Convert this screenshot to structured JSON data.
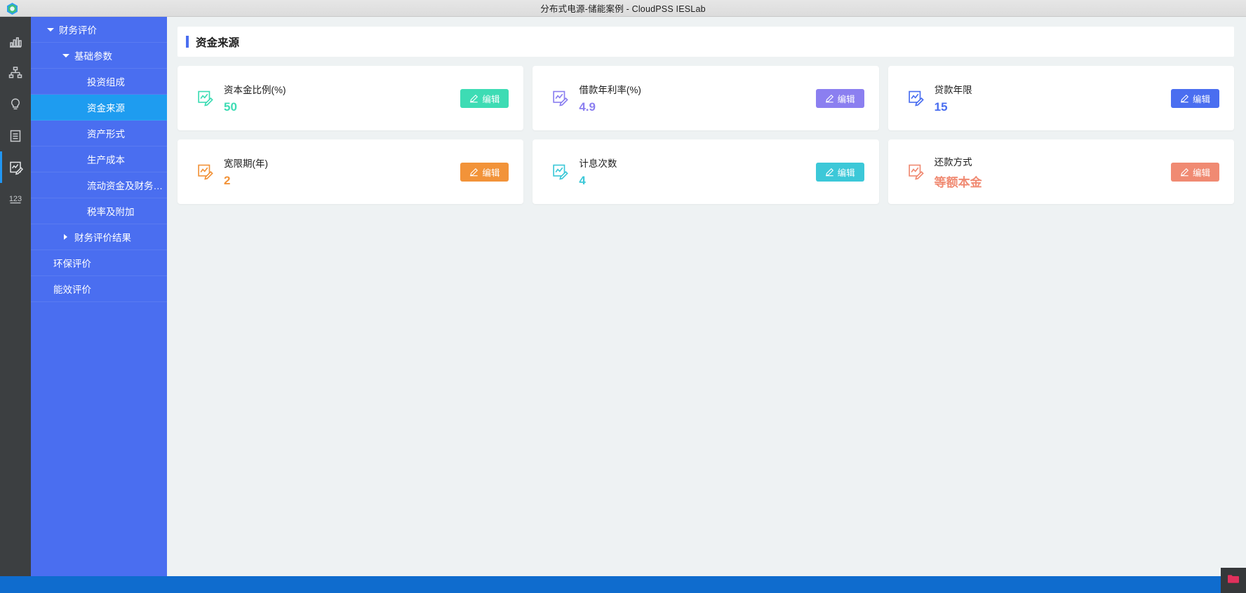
{
  "window": {
    "title": "分布式电源-储能案例 - CloudPSS IESLab",
    "logo_icon": "cloudpss-logo-icon"
  },
  "icon_rail": {
    "items": [
      {
        "icon": "bar-chart-icon",
        "active": false
      },
      {
        "icon": "org-tree-icon",
        "active": false
      },
      {
        "icon": "lightbulb-icon",
        "active": false
      },
      {
        "icon": "document-lines-icon",
        "active": false
      },
      {
        "icon": "edit-chart-icon",
        "active": true
      },
      {
        "icon": "numbers-123-icon",
        "active": false
      }
    ]
  },
  "sidebar": {
    "items": [
      {
        "label": "财务评价",
        "level": 1,
        "caret": "down",
        "selected": false
      },
      {
        "label": "基础参数",
        "level": 2,
        "caret": "down",
        "selected": false
      },
      {
        "label": "投资组成",
        "level": 3,
        "caret": "none",
        "selected": false
      },
      {
        "label": "资金来源",
        "level": 3,
        "caret": "none",
        "selected": true
      },
      {
        "label": "资产形式",
        "level": 3,
        "caret": "none",
        "selected": false
      },
      {
        "label": "生产成本",
        "level": 3,
        "caret": "none",
        "selected": false
      },
      {
        "label": "流动资金及财务…",
        "level": 3,
        "caret": "none",
        "selected": false
      },
      {
        "label": "税率及附加",
        "level": 3,
        "caret": "none",
        "selected": false
      },
      {
        "label": "财务评价结果",
        "level": 2,
        "caret": "right",
        "selected": false
      },
      {
        "label": "环保评价",
        "level": 0,
        "caret": "none",
        "selected": false
      },
      {
        "label": "能效评价",
        "level": 0,
        "caret": "none",
        "selected": false
      }
    ]
  },
  "panel": {
    "title": "资金来源",
    "accent_color": "#4a6ef0"
  },
  "cards": [
    {
      "label": "资本金比例(%)",
      "value": "50",
      "color": "#3ddcb4",
      "icon": "edit-chart-icon",
      "button_label": "编辑",
      "button_icon": "pencil-icon"
    },
    {
      "label": "借款年利率(%)",
      "value": "4.9",
      "color": "#8b7ff0",
      "icon": "edit-chart-icon",
      "button_label": "编辑",
      "button_icon": "pencil-icon"
    },
    {
      "label": "贷款年限",
      "value": "15",
      "color": "#4a6ef0",
      "icon": "edit-chart-icon",
      "button_label": "编辑",
      "button_icon": "pencil-icon"
    },
    {
      "label": "宽限期(年)",
      "value": "2",
      "color": "#f29339",
      "icon": "edit-chart-icon",
      "button_label": "编辑",
      "button_icon": "pencil-icon"
    },
    {
      "label": "计息次数",
      "value": "4",
      "color": "#3cc8d8",
      "icon": "edit-chart-icon",
      "button_label": "编辑",
      "button_icon": "pencil-icon"
    },
    {
      "label": "还款方式",
      "value": "等额本金",
      "color": "#f08a72",
      "icon": "edit-chart-icon",
      "button_label": "编辑",
      "button_icon": "pencil-icon"
    }
  ],
  "taskbar": {
    "color": "#0f6cce",
    "tray_icon": "folder-icon"
  }
}
